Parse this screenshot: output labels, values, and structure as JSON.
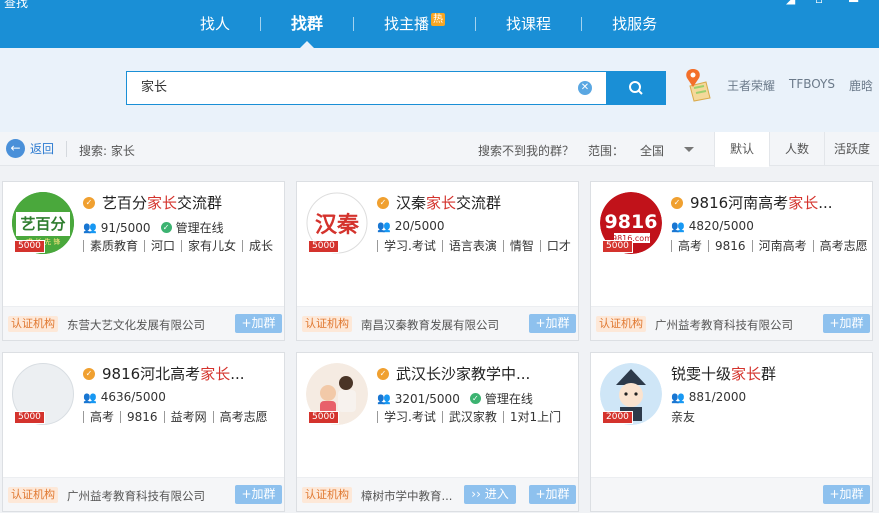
{
  "app": {
    "corner_label": "查找",
    "window_controls": [
      "◢",
      "▫",
      "▬"
    ]
  },
  "nav": {
    "tabs": [
      {
        "label": "找人",
        "active": false,
        "hot": ""
      },
      {
        "label": "找群",
        "active": true,
        "hot": ""
      },
      {
        "label": "找主播",
        "active": false,
        "hot": "热"
      },
      {
        "label": "找课程",
        "active": false,
        "hot": ""
      },
      {
        "label": "找服务",
        "active": false,
        "hot": ""
      }
    ]
  },
  "search": {
    "value": "家长",
    "clear_icon": "clear-icon",
    "button_icon": "search-icon",
    "hot_words": [
      "王者荣耀",
      "TFBOYS",
      "鹿晗"
    ]
  },
  "filter": {
    "back_label": "返回",
    "query_label": "搜索: 家长",
    "not_found": "搜索不到我的群？",
    "range_label": "范围：",
    "region": "全国",
    "sorts": [
      {
        "label": "默认",
        "active": true
      },
      {
        "label": "人数",
        "active": false
      },
      {
        "label": "活跃度",
        "active": false
      }
    ]
  },
  "cards": [
    {
      "name_pre": "艺百分",
      "name_hl": "家长",
      "name_post": "交流群",
      "verified": true,
      "members": "91/5000",
      "managed": "管理在线",
      "tags": [
        "素质教育",
        "河口",
        "家有儿女",
        "成长"
      ],
      "cap": "5000",
      "cert": "认证机构",
      "org": "东营大艺文化发展有限公司",
      "join": "+加群",
      "enter": "",
      "avatar_text": "艺百分",
      "avatar_sub": "成 长 先 锋",
      "avatar_color": "#2e8b2e"
    },
    {
      "name_pre": "汉秦",
      "name_hl": "家长",
      "name_post": "交流群",
      "verified": true,
      "members": "20/5000",
      "managed": "",
      "tags": [
        "学习.考试",
        "语言表演",
        "情智",
        "口才"
      ],
      "cap": "5000",
      "cert": "认证机构",
      "org": "南昌汉秦教育发展有限公司",
      "join": "+加群",
      "enter": "",
      "avatar_text": "汉秦",
      "avatar_sub": "",
      "avatar_color": "#d4332d"
    },
    {
      "name_pre": "9816河南高考",
      "name_hl": "家长",
      "name_post": "...",
      "verified": true,
      "members": "4820/5000",
      "managed": "",
      "tags": [
        "高考",
        "9816",
        "河南高考",
        "高考志愿"
      ],
      "cap": "5000",
      "cert": "认证机构",
      "org": "广州益考教育科技有限公司",
      "join": "+加群",
      "enter": "",
      "avatar_text": "9816",
      "avatar_sub": "9816.com",
      "avatar_color": "#c1121a"
    },
    {
      "name_pre": "9816河北高考",
      "name_hl": "家长",
      "name_post": "...",
      "verified": true,
      "members": "4636/5000",
      "managed": "",
      "tags": [
        "高考",
        "9816",
        "益考网",
        "高考志愿"
      ],
      "cap": "5000",
      "cert": "认证机构",
      "org": "广州益考教育科技有限公司",
      "join": "+加群",
      "enter": "",
      "avatar_text": "",
      "avatar_sub": "",
      "avatar_color": "#eceff2"
    },
    {
      "name_pre": "武汉长沙家教学中...",
      "name_hl": "",
      "name_post": "",
      "verified": true,
      "members": "3201/5000",
      "managed": "管理在线",
      "tags": [
        "学习.考试",
        "武汉家教",
        "1对1上门"
      ],
      "cap": "5000",
      "cert": "认证机构",
      "org": "樟树市学中教育...",
      "join": "+加群",
      "enter": "›› 进入",
      "avatar_text": "",
      "avatar_sub": "",
      "avatar_color": "#f3e6dc"
    },
    {
      "name_pre": "锐雯十级",
      "name_hl": "家长",
      "name_post": "群",
      "verified": false,
      "members": "881/2000",
      "managed": "",
      "tags": [
        "亲友"
      ],
      "cap": "2000",
      "cert": "",
      "org": "",
      "join": "+加群",
      "enter": "",
      "avatar_text": "",
      "avatar_sub": "",
      "avatar_color": "#cfe6f7"
    }
  ]
}
